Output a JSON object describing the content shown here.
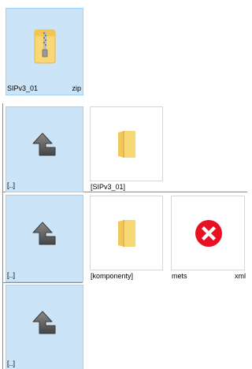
{
  "panels": [
    {
      "items": [
        {
          "name": "SIPv3_01",
          "ext": "zip",
          "icon": "zip-archive-icon",
          "selected": true
        }
      ]
    },
    {
      "items": [
        {
          "name": "[..]",
          "icon": "up-arrow-icon",
          "selected": true
        },
        {
          "name": "[SIPv3_01]",
          "icon": "folder-icon",
          "selected": false
        }
      ]
    },
    {
      "items": [
        {
          "name": "[..]",
          "icon": "up-arrow-icon",
          "selected": true
        },
        {
          "name": "[komponenty]",
          "icon": "folder-icon",
          "selected": false
        },
        {
          "name": "mets",
          "ext": "xml",
          "icon": "xml-file-error-icon",
          "selected": false
        }
      ]
    },
    {
      "items": [
        {
          "name": "[..]",
          "icon": "up-arrow-icon",
          "selected": true
        }
      ]
    }
  ],
  "colors": {
    "selection_fill": "#cce4f7",
    "selection_border": "#99d1ff",
    "folder": "#f8d775",
    "error_badge": "#e81123"
  }
}
